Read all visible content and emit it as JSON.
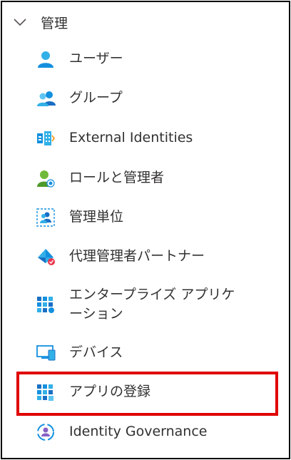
{
  "section": {
    "title": "管理",
    "chevron": "chevron-down-icon"
  },
  "items": [
    {
      "label": "ユーザー",
      "icon": "user-icon"
    },
    {
      "label": "グループ",
      "icon": "group-icon"
    },
    {
      "label": "External Identities",
      "icon": "external-identities-icon"
    },
    {
      "label": "ロールと管理者",
      "icon": "roles-admins-icon"
    },
    {
      "label": "管理単位",
      "icon": "admin-units-icon"
    },
    {
      "label": "代理管理者パートナー",
      "icon": "delegated-admin-partners-icon"
    },
    {
      "label": "エンタープライズ アプリケーション",
      "icon": "enterprise-apps-icon"
    },
    {
      "label": "デバイス",
      "icon": "devices-icon"
    },
    {
      "label": "アプリの登録",
      "icon": "app-registrations-icon"
    },
    {
      "label": "Identity Governance",
      "icon": "identity-governance-icon"
    }
  ],
  "colors": {
    "accent_blue": "#1490df",
    "highlight": "#e00000",
    "text": "#323130"
  }
}
